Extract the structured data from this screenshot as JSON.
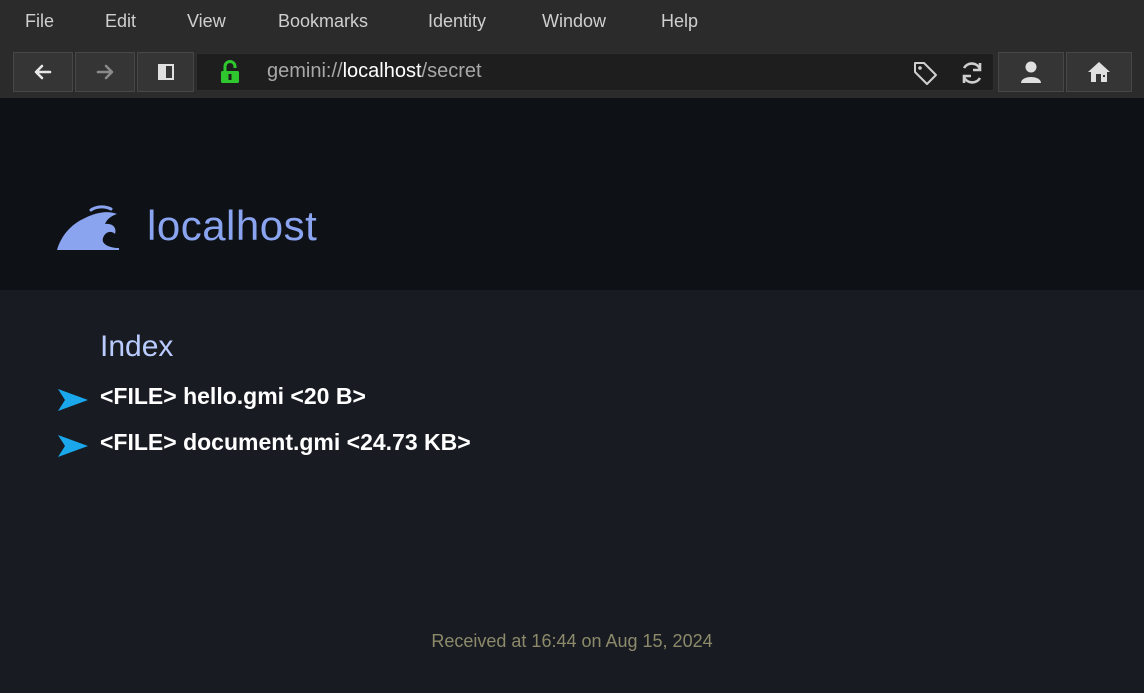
{
  "menu": [
    "File",
    "Edit",
    "View",
    "Bookmarks",
    "Identity",
    "Window",
    "Help"
  ],
  "toolbar": {
    "back_icon": "arrow-left-icon",
    "forward_icon": "arrow-right-icon",
    "sidebar_icon": "sidebar-toggle-icon",
    "lock_icon": "padlock-open-icon",
    "url_scheme": "gemini://",
    "url_host": "localhost",
    "url_path": "/secret",
    "tag_icon": "bookmark-tag-icon",
    "reload_icon": "reload-icon",
    "identity_icon": "person-icon",
    "home_icon": "home-icon"
  },
  "banner": {
    "site_icon": "wave-icon",
    "site_name": "localhost"
  },
  "content": {
    "heading": "Index",
    "links": [
      "<FILE> hello.gmi <20 B>",
      "<FILE> document.gmi <24.73 KB>"
    ]
  },
  "footer": {
    "received": "Received at 16:44 on Aug 15, 2024"
  },
  "colors": {
    "accent_link_arrow": "#1aa7ec",
    "lock_green": "#2ec82e",
    "site_title": "#8aa4f0"
  }
}
